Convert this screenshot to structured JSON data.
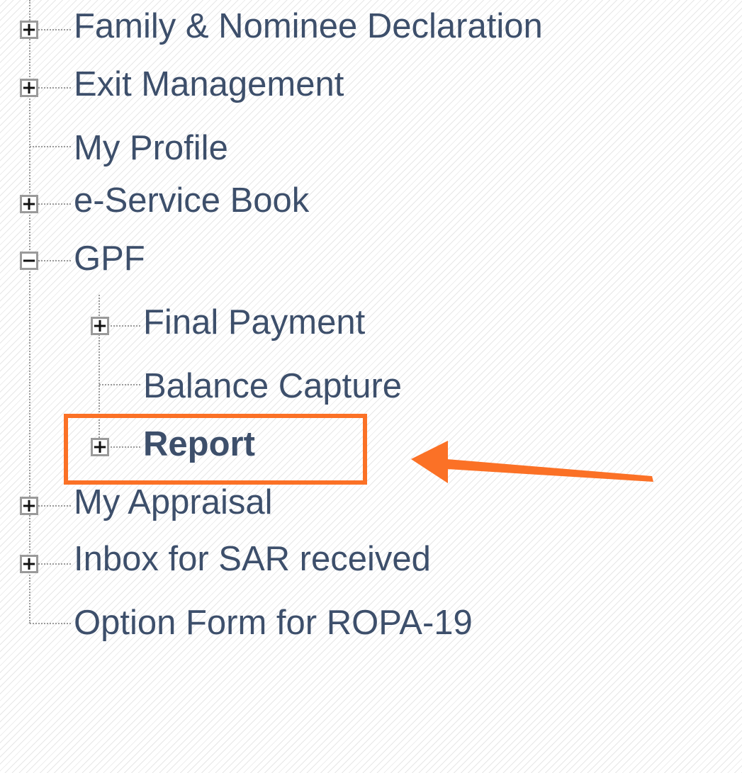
{
  "tree": {
    "items": [
      {
        "label": "Family & Nominee Declaration",
        "toggle": "+"
      },
      {
        "label": "Exit Management",
        "toggle": "+"
      },
      {
        "label": "My Profile"
      },
      {
        "label": "e-Service Book",
        "toggle": "+"
      },
      {
        "label": "GPF",
        "toggle": "−"
      },
      {
        "label": "Final Payment",
        "toggle": "+"
      },
      {
        "label": "Balance Capture"
      },
      {
        "label": "Report",
        "toggle": "+"
      },
      {
        "label": "My Appraisal",
        "toggle": "+"
      },
      {
        "label": "Inbox for SAR received",
        "toggle": "+"
      },
      {
        "label": "Option Form for ROPA-19"
      }
    ]
  },
  "annotation": {
    "highlight_color": "#fb7126",
    "highlighted_item": "Report",
    "arrow_icon": "left-arrow-icon"
  },
  "colors": {
    "text": "#3d4f6b",
    "connector": "#9a9a9a"
  }
}
